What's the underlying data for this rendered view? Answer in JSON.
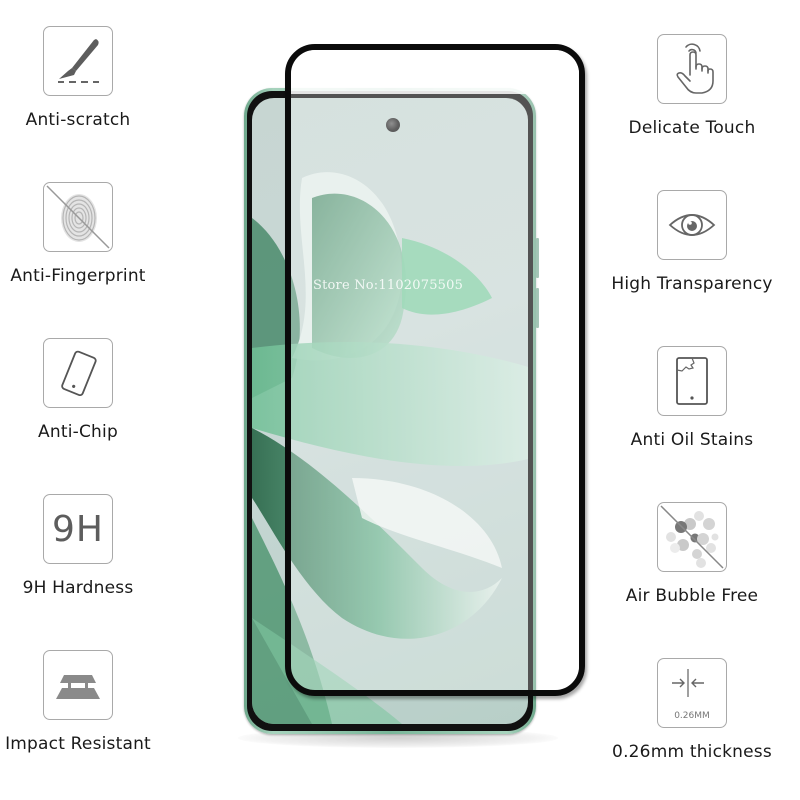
{
  "product": {
    "watermark": "Store No:1102075505",
    "colors": {
      "phone_frame": "#7ab79a",
      "screen_bg": "#c9d8d6",
      "protector_border": "#0b0b0b",
      "icon_border": "#a9a9a9",
      "icon_fill": "#5d5d5d",
      "label_text": "#1a1a1a"
    }
  },
  "features_left": [
    {
      "label": "Anti-scratch",
      "icon": "scalpel-scratch-icon"
    },
    {
      "label": "Anti-Fingerprint",
      "icon": "fingerprint-crossed-icon"
    },
    {
      "label": "Anti-Chip",
      "icon": "tilted-phone-icon"
    },
    {
      "label": "9H Hardness",
      "icon": "9h-icon",
      "icon_text": "9H"
    },
    {
      "label": "Impact Resistant",
      "icon": "layers-impact-icon"
    }
  ],
  "features_right": [
    {
      "label": "Delicate Touch",
      "icon": "touch-hand-icon"
    },
    {
      "label": "High Transparency",
      "icon": "eye-icon"
    },
    {
      "label": "Anti Oil Stains",
      "icon": "cracked-phone-icon"
    },
    {
      "label": "Air Bubble Free",
      "icon": "bubbles-crossed-icon"
    },
    {
      "label": "0.26mm thickness",
      "icon": "thickness-arrows-icon",
      "icon_text": "0.26MM"
    }
  ]
}
